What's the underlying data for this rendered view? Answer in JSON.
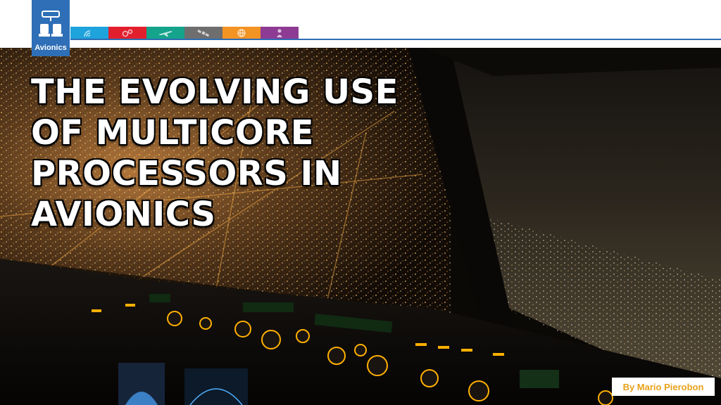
{
  "section": {
    "label": "Avionics",
    "icon": "cockpit-seats-icon",
    "color": "#2e6fb7"
  },
  "tabs": [
    {
      "icon": "signal-waves-icon",
      "color": "#1fa3dc"
    },
    {
      "icon": "gears-icon",
      "color": "#e21f2d"
    },
    {
      "icon": "airplane-icon",
      "color": "#14a38b"
    },
    {
      "icon": "satellite-icon",
      "color": "#6e6e6e"
    },
    {
      "icon": "globe-icon",
      "color": "#f39324"
    },
    {
      "icon": "person-icon",
      "color": "#8e3b94"
    }
  ],
  "title_lines": [
    "THE EVOLVING USE",
    "OF MULTICORE",
    "PROCESSORS IN",
    "AVIONICS"
  ],
  "byline": "By Mario Pierobon",
  "photo": {
    "description_icon": "cockpit-night-city-photo"
  }
}
